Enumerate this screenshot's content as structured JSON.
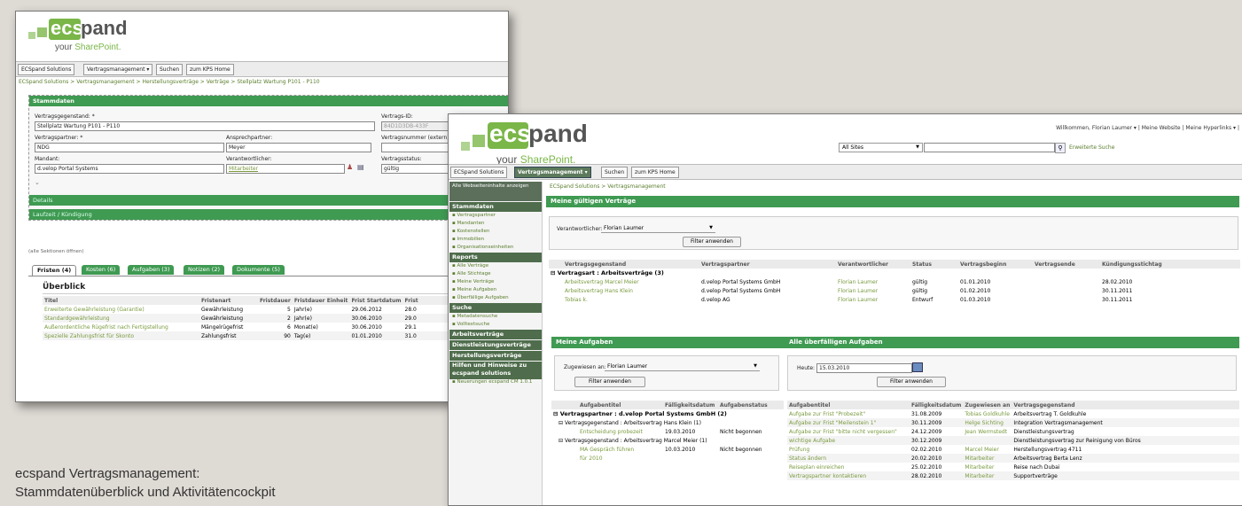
{
  "logo": {
    "ec": "ec",
    "s": "s",
    "pand": "pand",
    "your": "your ",
    "sharepoint": "SharePoint."
  },
  "win1": {
    "nav": [
      "ECSpand Solutions",
      "Vertragsmanagement ▾",
      "Suchen",
      "zum KPS Home"
    ],
    "breadcrumb": "ECSpand Solutions > Vertragsmanagement > Herstellungsverträge > Verträge > Stellplatz Wartung P101 - P110",
    "section_title": "Stammdaten",
    "fields": {
      "gegenstand_label": "Vertragsgegenstand: *",
      "gegenstand_value": "Stellplatz Wartung P101 - P110",
      "id_label": "Vertrags-ID:",
      "id_value": "84D1D3DB-433F",
      "partner_label": "Vertragspartner: *",
      "partner_value": "NDG",
      "ansprech_label": "Ansprechpartner:",
      "ansprech_value": "Meyer",
      "nummer_label": "Vertragsnummer (extern)",
      "mandant_label": "Mandant:",
      "mandant_value": "d.velop Portal Systems",
      "verantw_label": "Verantwortlicher:",
      "verantw_value": "Mitarbeiter",
      "status_label": "Vertragsstatus:",
      "status_value": "gültig"
    },
    "bars": [
      "Details",
      "Laufzeit / Kündigung"
    ],
    "expand_all": "(alle Sektionen öffnen)",
    "tabs": [
      "Fristen (4)",
      "Kosten (6)",
      "Aufgaben (3)",
      "Notizen (2)",
      "Dokumente (5)"
    ],
    "overview_title": "Überblick",
    "table_headers": [
      "Titel",
      "Fristenart",
      "Fristdauer",
      "Fristdauer Einheit",
      "Frist Startdatum",
      "Frist"
    ],
    "table_rows": [
      [
        "Erweiterte Gewährleistung (Garantie)",
        "Gewährleistung",
        "5",
        "Jahr(e)",
        "29.06.2012",
        "28.0"
      ],
      [
        "Standardgewährleistung",
        "Gewährleistung",
        "2",
        "Jahr(e)",
        "30.06.2010",
        "29.0"
      ],
      [
        "Außerordentliche Rügefrist nach Fertigstellung",
        "Mängelrügefrist",
        "6",
        "Monat(e)",
        "30.06.2010",
        "29.1"
      ],
      [
        "Spezielle Zahlungsfrist für Skonto",
        "Zahlungsfrist",
        "90",
        "Tag(e)",
        "01.01.2010",
        "31.0"
      ]
    ]
  },
  "win2": {
    "welcome": "Willkommen, Florian Laumer ▾  |  Meine Website  |  Meine Hyperlinks ▾  |",
    "scope": "All Sites",
    "adv_search": "Erweiterte Suche",
    "nav": [
      "ECSpand Solutions",
      "Vertragsmanagement ▾",
      "Suchen",
      "zum KPS Home"
    ],
    "breadcrumb": "ECSpand Solutions > Vertragsmanagement",
    "sidebar": {
      "hide": "Alle Webseiteninhalte anzeigen",
      "groups": [
        {
          "title": "Stammdaten",
          "items": [
            "Vertragspartner",
            "Mandanten",
            "Kostenstellen",
            "Immobilien",
            "Organisationseinheiten"
          ]
        },
        {
          "title": "Reports",
          "items": [
            "Alle Verträge",
            "Alle Stichtage",
            "Meine Verträge",
            "Meine Aufgaben",
            "Überfällige Aufgaben"
          ]
        },
        {
          "title": "Suche",
          "items": [
            "Metadatensuche",
            "Volltextsuche"
          ]
        },
        {
          "title": "Arbeitsverträge",
          "items": []
        },
        {
          "title": "Dienstleistungsverträge",
          "items": []
        },
        {
          "title": "Herstellungsverträge",
          "items": []
        },
        {
          "title": "Hilfen und Hinweise zu ecspand solutions",
          "items": [
            "Neuerungen ecspand CM 1.0.1"
          ]
        }
      ]
    },
    "vertraege": {
      "title": "Meine gültigen Verträge",
      "verantw_label": "Verantwortlicher:",
      "verantw_value": "Florian Laumer",
      "filter_btn": "Filter anwenden",
      "headers": [
        "Vertragsgegenstand",
        "Vertragspartner",
        "Verantwortlicher",
        "Status",
        "Vertragsbeginn",
        "Vertragsende",
        "Kündigungsstichtag"
      ],
      "group": "Vertragsart : Arbeitsverträge (3)",
      "rows": [
        [
          "Arbeitsvertrag Marcel Meier",
          "d.velop Portal Systems GmbH",
          "Florian Laumer",
          "gültig",
          "01.01.2010",
          "",
          "28.02.2010"
        ],
        [
          "Arbeitsvertrag Hans Klein",
          "d.velop Portal Systems GmbH",
          "Florian Laumer",
          "gültig",
          "01.02.2010",
          "",
          "30.11.2011"
        ],
        [
          "Tobias k.",
          "d.velop AG",
          "Florian Laumer",
          "Entwurf",
          "01.03.2010",
          "",
          "30.11.2011"
        ]
      ]
    },
    "aufgaben": {
      "title": "Meine Aufgaben",
      "assign_label": "Zugewiesen an:",
      "assign_value": "Florian Laumer",
      "filter_btn": "Filter anwenden",
      "headers": [
        "Aufgabentitel",
        "Fälligkeitsdatum",
        "Aufgabenstatus"
      ],
      "group": "Vertragspartner : d.velop Portal Systems GmbH (2)",
      "sub1": "Vertragsgegenstand : Arbeitsvertrag Hans Klein (1)",
      "row1": [
        "Entscheidung probezeit",
        "19.03.2010",
        "Nicht begonnen"
      ],
      "sub2": "Vertragsgegenstand : Arbeitsvertrag Marcel Meier (1)",
      "row2a": "MA Gespräch führen",
      "row2b": "für 2010",
      "row2": [
        "10.03.2010",
        "Nicht begonnen"
      ]
    },
    "ueberfaellig": {
      "title": "Alle überfälligen Aufgaben",
      "heute_label": "Heute:",
      "heute_value": "15.03.2010",
      "filter_btn": "Filter anwenden",
      "headers": [
        "Aufgabentitel",
        "Fälligkeitsdatum",
        "Zugewiesen an",
        "Vertragsgegenstand"
      ],
      "rows": [
        [
          "Aufgabe zur Frist \"Probezeit\"",
          "31.08.2009",
          "Tobias Goldkuhle",
          "Arbeitsvertrag T. Goldkuhle"
        ],
        [
          "Aufgabe zur Frist \"Meilenstein 1\"",
          "30.11.2009",
          "Helge Sichting",
          "Integration Vertragsmanagement"
        ],
        [
          "Aufgabe zur Frist \"bitte nicht vergessen\"",
          "24.12.2009",
          "Jean Wermstedt",
          "Dienstleistungsvertrag"
        ],
        [
          "wichtige Aufgabe",
          "30.12.2009",
          "",
          "Dienstleistungsvertrag zur Reinigung von Büros"
        ],
        [
          "Prüfung",
          "02.02.2010",
          "Marcel Meier",
          "Herstellungsvertrag 4711"
        ],
        [
          "Status ändern",
          "20.02.2010",
          "Mitarbeiter",
          "Arbeitsvertrag Berta Lenz"
        ],
        [
          "Reiseplan einreichen",
          "25.02.2010",
          "Mitarbeiter",
          "Reise nach Dubai"
        ],
        [
          "Vertragspartner kontaktieren",
          "28.02.2010",
          "Mitarbeiter",
          "Supportverträge"
        ]
      ]
    }
  },
  "caption": [
    "ecspand Vertragsmanagement:",
    "Stammdatenüberblick und Aktivitätencockpit"
  ]
}
